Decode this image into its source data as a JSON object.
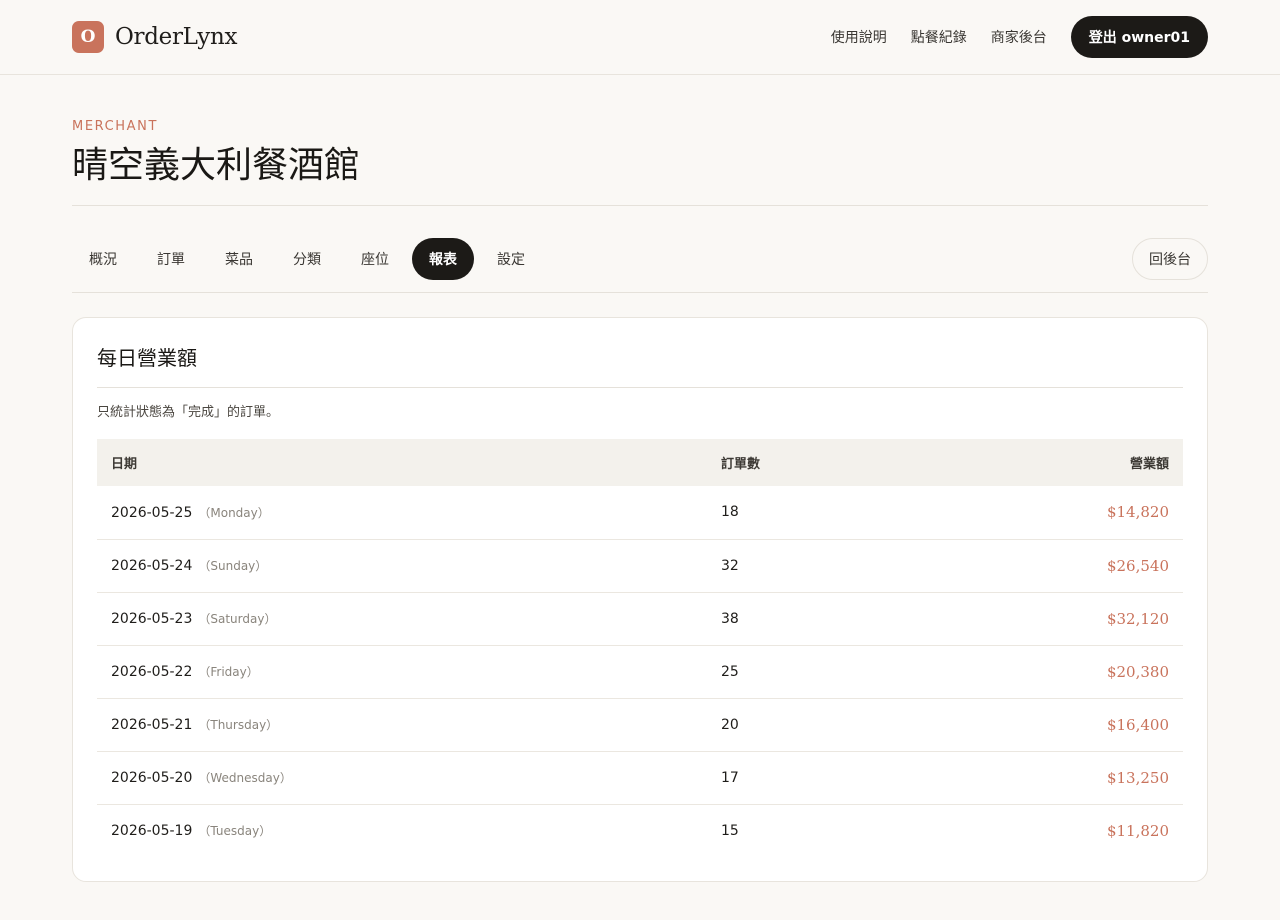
{
  "header": {
    "logo_letter": "O",
    "brand": "OrderLynx",
    "nav": [
      "使用說明",
      "點餐紀錄",
      "商家後台"
    ],
    "logout_label": "登出 owner01"
  },
  "merchant": {
    "eyebrow": "MERCHANT",
    "name": "晴空義大利餐酒館"
  },
  "tabs": {
    "items": [
      "概況",
      "訂單",
      "菜品",
      "分類",
      "座位",
      "報表",
      "設定"
    ],
    "active": "報表",
    "back_label": "回後台"
  },
  "report": {
    "title": "每日營業額",
    "note": "只統計狀態為「完成」的訂單。",
    "columns": [
      "日期",
      "訂單數",
      "營業額"
    ],
    "rows": [
      {
        "date": "2026-05-25",
        "weekday": "（Monday）",
        "orders": "18",
        "revenue": "$14,820"
      },
      {
        "date": "2026-05-24",
        "weekday": "（Sunday）",
        "orders": "32",
        "revenue": "$26,540"
      },
      {
        "date": "2026-05-23",
        "weekday": "（Saturday）",
        "orders": "38",
        "revenue": "$32,120"
      },
      {
        "date": "2026-05-22",
        "weekday": "（Friday）",
        "orders": "25",
        "revenue": "$20,380"
      },
      {
        "date": "2026-05-21",
        "weekday": "（Thursday）",
        "orders": "20",
        "revenue": "$16,400"
      },
      {
        "date": "2026-05-20",
        "weekday": "（Wednesday）",
        "orders": "17",
        "revenue": "$13,250"
      },
      {
        "date": "2026-05-19",
        "weekday": "（Tuesday）",
        "orders": "15",
        "revenue": "$11,820"
      }
    ]
  },
  "colors": {
    "accent": "#c9735c",
    "dark": "#1c1a17",
    "background": "#faf8f5"
  }
}
